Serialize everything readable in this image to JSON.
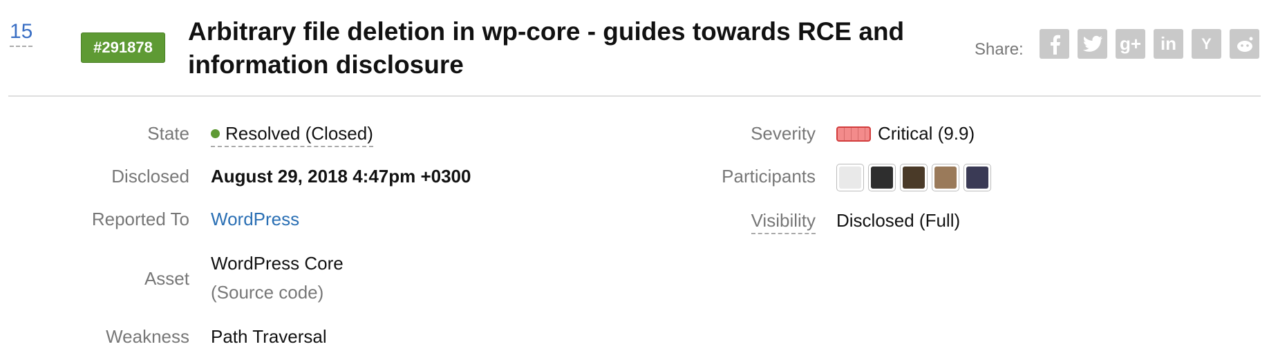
{
  "header": {
    "vote_count": "15",
    "report_id": "#291878",
    "title": "Arbitrary file deletion in wp-core - guides towards RCE and information disclosure",
    "share_label": "Share:",
    "share_icons": [
      "facebook-icon",
      "twitter-icon",
      "google-plus-icon",
      "linkedin-icon",
      "hacker-news-icon",
      "reddit-icon"
    ]
  },
  "details_left": {
    "state": {
      "label": "State",
      "value": "Resolved (Closed)",
      "color": "#5e9a34"
    },
    "disclosed": {
      "label": "Disclosed",
      "value": "August 29, 2018 4:47pm +0300"
    },
    "reported_to": {
      "label": "Reported To",
      "value": "WordPress"
    },
    "asset": {
      "label": "Asset",
      "value": "WordPress Core",
      "sub": "(Source code)"
    },
    "weakness": {
      "label": "Weakness",
      "value": "Path Traversal"
    }
  },
  "details_right": {
    "severity": {
      "label": "Severity",
      "value": "Critical (9.9)",
      "color": "#d23c3c"
    },
    "participants": {
      "label": "Participants",
      "avatars": [
        "avatar-default",
        "avatar-user-1",
        "avatar-user-2",
        "avatar-user-3",
        "avatar-user-4"
      ]
    },
    "visibility": {
      "label": "Visibility",
      "value": "Disclosed (Full)"
    }
  }
}
